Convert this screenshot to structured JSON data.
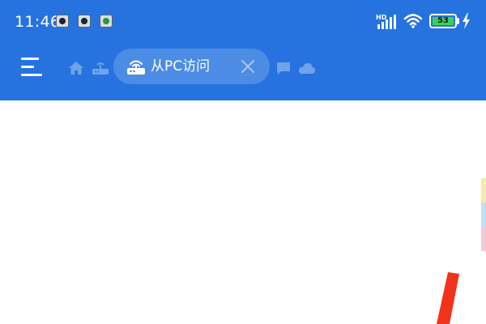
{
  "status_bar": {
    "time": "11:46",
    "notification_icons": [
      "app-notification-icon",
      "app-notification-icon",
      "green-app-notification-icon"
    ],
    "network": "HD",
    "battery_level": "53",
    "charging": true
  },
  "toolbar": {
    "menu_icon": "hamburger-menu-icon",
    "tabs": [
      {
        "icon": "home-icon"
      },
      {
        "icon": "router-icon"
      },
      {
        "label": "从PC访问",
        "icon": "router-wifi-icon",
        "active": true,
        "close_icon": "close-icon"
      },
      {
        "icon": "chat-icon"
      },
      {
        "icon": "cloud-icon"
      }
    ]
  },
  "colors": {
    "header": "#2673e0",
    "content_background": "#ffffff",
    "battery_fill": "#3cd155",
    "red_stroke": "#f2321b"
  }
}
